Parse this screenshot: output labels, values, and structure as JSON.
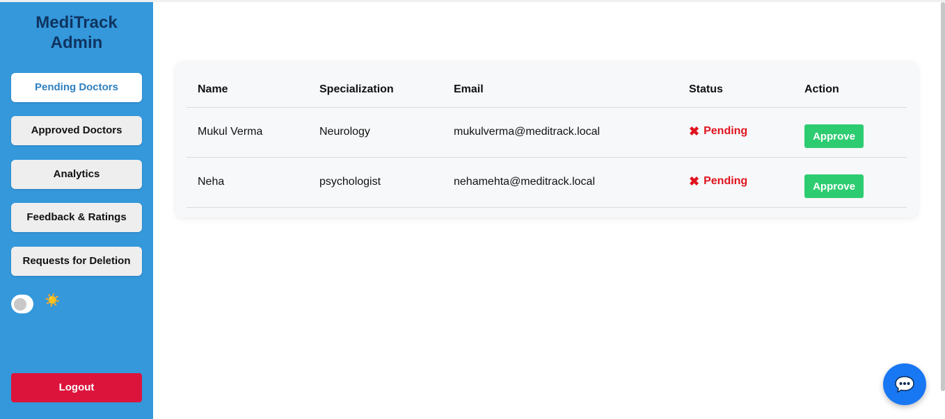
{
  "sidebar": {
    "brand_line1": "MediTrack",
    "brand_line2": "Admin",
    "items": [
      {
        "label": "Pending Doctors"
      },
      {
        "label": "Approved Doctors"
      },
      {
        "label": "Analytics"
      },
      {
        "label": "Feedback & Ratings"
      },
      {
        "label": "Requests for Deletion"
      }
    ],
    "theme_icon": "☀️",
    "logout_label": "Logout"
  },
  "table": {
    "headers": [
      "Name",
      "Specialization",
      "Email",
      "Status",
      "Action"
    ],
    "rows": [
      {
        "name": "Mukul Verma",
        "specialization": "Neurology",
        "email": "mukulverma@meditrack.local",
        "status": "Pending",
        "action": "Approve"
      },
      {
        "name": "Neha",
        "specialization": "psychologist",
        "email": "nehamehta@meditrack.local",
        "status": "Pending",
        "action": "Approve"
      }
    ]
  },
  "icons": {
    "status_icon": "cross-mark-icon",
    "chat_icon": "chat-bubble-icon",
    "theme_icon": "sun-icon"
  },
  "colors": {
    "sidebar": "#3498db",
    "brand": "#0f3460",
    "pending": "#e0141e",
    "approve": "#2ecc71",
    "logout": "#dc143c",
    "chat": "#1877f2"
  }
}
